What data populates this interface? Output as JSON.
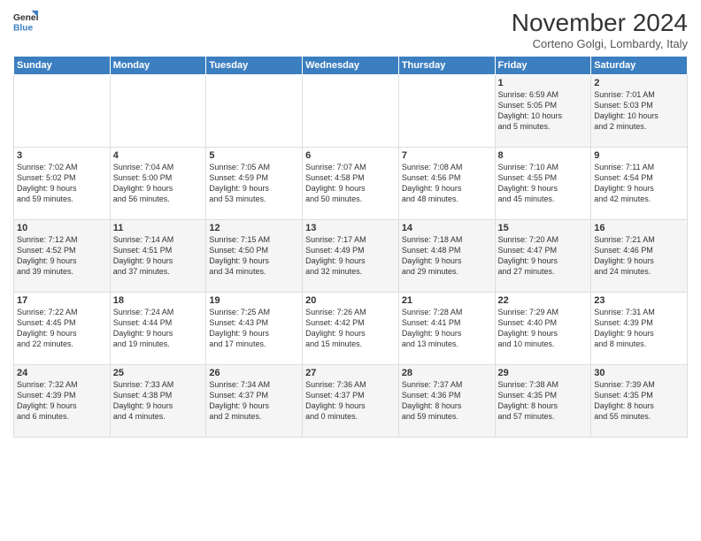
{
  "header": {
    "logo_line1": "General",
    "logo_line2": "Blue",
    "month": "November 2024",
    "location": "Corteno Golgi, Lombardy, Italy"
  },
  "days_of_week": [
    "Sunday",
    "Monday",
    "Tuesday",
    "Wednesday",
    "Thursday",
    "Friday",
    "Saturday"
  ],
  "weeks": [
    [
      {
        "day": "",
        "info": ""
      },
      {
        "day": "",
        "info": ""
      },
      {
        "day": "",
        "info": ""
      },
      {
        "day": "",
        "info": ""
      },
      {
        "day": "",
        "info": ""
      },
      {
        "day": "1",
        "info": "Sunrise: 6:59 AM\nSunset: 5:05 PM\nDaylight: 10 hours\nand 5 minutes."
      },
      {
        "day": "2",
        "info": "Sunrise: 7:01 AM\nSunset: 5:03 PM\nDaylight: 10 hours\nand 2 minutes."
      }
    ],
    [
      {
        "day": "3",
        "info": "Sunrise: 7:02 AM\nSunset: 5:02 PM\nDaylight: 9 hours\nand 59 minutes."
      },
      {
        "day": "4",
        "info": "Sunrise: 7:04 AM\nSunset: 5:00 PM\nDaylight: 9 hours\nand 56 minutes."
      },
      {
        "day": "5",
        "info": "Sunrise: 7:05 AM\nSunset: 4:59 PM\nDaylight: 9 hours\nand 53 minutes."
      },
      {
        "day": "6",
        "info": "Sunrise: 7:07 AM\nSunset: 4:58 PM\nDaylight: 9 hours\nand 50 minutes."
      },
      {
        "day": "7",
        "info": "Sunrise: 7:08 AM\nSunset: 4:56 PM\nDaylight: 9 hours\nand 48 minutes."
      },
      {
        "day": "8",
        "info": "Sunrise: 7:10 AM\nSunset: 4:55 PM\nDaylight: 9 hours\nand 45 minutes."
      },
      {
        "day": "9",
        "info": "Sunrise: 7:11 AM\nSunset: 4:54 PM\nDaylight: 9 hours\nand 42 minutes."
      }
    ],
    [
      {
        "day": "10",
        "info": "Sunrise: 7:12 AM\nSunset: 4:52 PM\nDaylight: 9 hours\nand 39 minutes."
      },
      {
        "day": "11",
        "info": "Sunrise: 7:14 AM\nSunset: 4:51 PM\nDaylight: 9 hours\nand 37 minutes."
      },
      {
        "day": "12",
        "info": "Sunrise: 7:15 AM\nSunset: 4:50 PM\nDaylight: 9 hours\nand 34 minutes."
      },
      {
        "day": "13",
        "info": "Sunrise: 7:17 AM\nSunset: 4:49 PM\nDaylight: 9 hours\nand 32 minutes."
      },
      {
        "day": "14",
        "info": "Sunrise: 7:18 AM\nSunset: 4:48 PM\nDaylight: 9 hours\nand 29 minutes."
      },
      {
        "day": "15",
        "info": "Sunrise: 7:20 AM\nSunset: 4:47 PM\nDaylight: 9 hours\nand 27 minutes."
      },
      {
        "day": "16",
        "info": "Sunrise: 7:21 AM\nSunset: 4:46 PM\nDaylight: 9 hours\nand 24 minutes."
      }
    ],
    [
      {
        "day": "17",
        "info": "Sunrise: 7:22 AM\nSunset: 4:45 PM\nDaylight: 9 hours\nand 22 minutes."
      },
      {
        "day": "18",
        "info": "Sunrise: 7:24 AM\nSunset: 4:44 PM\nDaylight: 9 hours\nand 19 minutes."
      },
      {
        "day": "19",
        "info": "Sunrise: 7:25 AM\nSunset: 4:43 PM\nDaylight: 9 hours\nand 17 minutes."
      },
      {
        "day": "20",
        "info": "Sunrise: 7:26 AM\nSunset: 4:42 PM\nDaylight: 9 hours\nand 15 minutes."
      },
      {
        "day": "21",
        "info": "Sunrise: 7:28 AM\nSunset: 4:41 PM\nDaylight: 9 hours\nand 13 minutes."
      },
      {
        "day": "22",
        "info": "Sunrise: 7:29 AM\nSunset: 4:40 PM\nDaylight: 9 hours\nand 10 minutes."
      },
      {
        "day": "23",
        "info": "Sunrise: 7:31 AM\nSunset: 4:39 PM\nDaylight: 9 hours\nand 8 minutes."
      }
    ],
    [
      {
        "day": "24",
        "info": "Sunrise: 7:32 AM\nSunset: 4:39 PM\nDaylight: 9 hours\nand 6 minutes."
      },
      {
        "day": "25",
        "info": "Sunrise: 7:33 AM\nSunset: 4:38 PM\nDaylight: 9 hours\nand 4 minutes."
      },
      {
        "day": "26",
        "info": "Sunrise: 7:34 AM\nSunset: 4:37 PM\nDaylight: 9 hours\nand 2 minutes."
      },
      {
        "day": "27",
        "info": "Sunrise: 7:36 AM\nSunset: 4:37 PM\nDaylight: 9 hours\nand 0 minutes."
      },
      {
        "day": "28",
        "info": "Sunrise: 7:37 AM\nSunset: 4:36 PM\nDaylight: 8 hours\nand 59 minutes."
      },
      {
        "day": "29",
        "info": "Sunrise: 7:38 AM\nSunset: 4:35 PM\nDaylight: 8 hours\nand 57 minutes."
      },
      {
        "day": "30",
        "info": "Sunrise: 7:39 AM\nSunset: 4:35 PM\nDaylight: 8 hours\nand 55 minutes."
      }
    ]
  ]
}
